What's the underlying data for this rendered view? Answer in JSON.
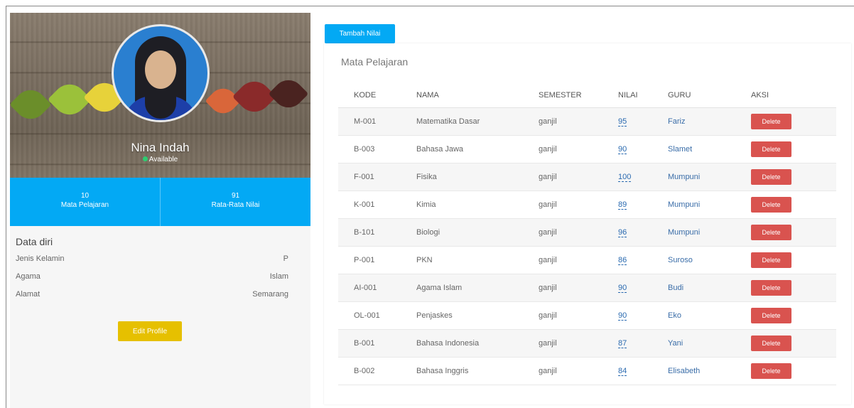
{
  "profile": {
    "name": "Nina Indah",
    "status": "Available",
    "stats": [
      {
        "value": "10",
        "label": "Mata Pelajaran"
      },
      {
        "value": "91",
        "label": "Rata-Rata Nilai"
      }
    ],
    "data_diri": {
      "title": "Data diri",
      "rows": [
        {
          "label": "Jenis Kelamin",
          "value": "P"
        },
        {
          "label": "Agama",
          "value": "Islam"
        },
        {
          "label": "Alamat",
          "value": "Semarang"
        }
      ]
    },
    "edit_label": "Edit Profile"
  },
  "toolbar": {
    "tambah_label": "Tambah Nilai"
  },
  "panel": {
    "title": "Mata Pelajaran",
    "columns": [
      "KODE",
      "NAMA",
      "SEMESTER",
      "NILAI",
      "GURU",
      "AKSI"
    ],
    "delete_label": "Delete",
    "rows": [
      {
        "kode": "M-001",
        "nama": "Matematika Dasar",
        "semester": "ganjil",
        "nilai": "95",
        "guru": "Fariz"
      },
      {
        "kode": "B-003",
        "nama": "Bahasa Jawa",
        "semester": "ganjil",
        "nilai": "90",
        "guru": "Slamet"
      },
      {
        "kode": "F-001",
        "nama": "Fisika",
        "semester": "ganjil",
        "nilai": "100",
        "guru": "Mumpuni"
      },
      {
        "kode": "K-001",
        "nama": "Kimia",
        "semester": "ganjil",
        "nilai": "89",
        "guru": "Mumpuni"
      },
      {
        "kode": "B-101",
        "nama": "Biologi",
        "semester": "ganjil",
        "nilai": "96",
        "guru": "Mumpuni"
      },
      {
        "kode": "P-001",
        "nama": "PKN",
        "semester": "ganjil",
        "nilai": "86",
        "guru": "Suroso"
      },
      {
        "kode": "AI-001",
        "nama": "Agama Islam",
        "semester": "ganjil",
        "nilai": "90",
        "guru": "Budi"
      },
      {
        "kode": "OL-001",
        "nama": "Penjaskes",
        "semester": "ganjil",
        "nilai": "90",
        "guru": "Eko"
      },
      {
        "kode": "B-001",
        "nama": "Bahasa Indonesia",
        "semester": "ganjil",
        "nilai": "87",
        "guru": "Yani"
      },
      {
        "kode": "B-002",
        "nama": "Bahasa Inggris",
        "semester": "ganjil",
        "nilai": "84",
        "guru": "Elisabeth"
      }
    ]
  },
  "colors": {
    "accent": "#03a9f4",
    "edit_button": "#e6c000",
    "delete_button": "#d9534f",
    "status_dot": "#2ecc71",
    "link": "#2a6ab0"
  },
  "icons": [
    "avatar-photo",
    "status-dot-icon"
  ]
}
